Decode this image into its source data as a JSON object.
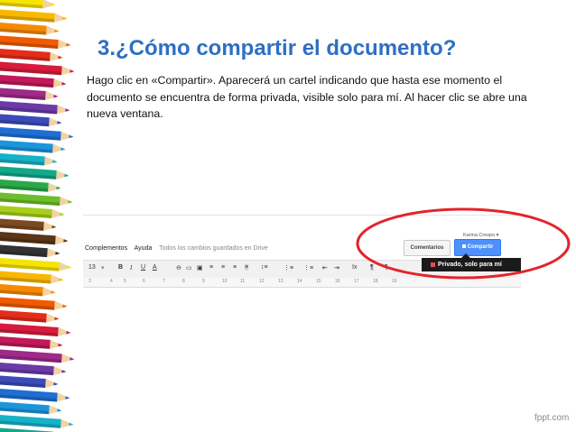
{
  "slide": {
    "title": "3.¿Cómo compartir el documento?",
    "body": "Hago clic en «Compartir». Aparecerá un cartel indicando que hasta ese momento el documento se encuentra de forma privada, visible solo para mí. Al hacer clic se abre una nueva ventana."
  },
  "screenshot": {
    "menu": [
      "Complementos",
      "Ayuda"
    ],
    "saved_status": "Todos los cambios guardados en Drive",
    "user_name": "Karina Crespo ▾",
    "comments_button": "Comentarios",
    "share_button": "Compartir",
    "share_tooltip": "Privado, solo para mí",
    "font_size": "13",
    "ruler_ticks": [
      "3",
      "4",
      "5",
      "6",
      "7",
      "8",
      "9",
      "10",
      "11",
      "12",
      "13",
      "14",
      "15",
      "16",
      "17",
      "18",
      "19"
    ]
  },
  "footer": {
    "logo": "fppt.com"
  },
  "colors": {
    "title": "#2e6fc4",
    "share_button": "#4d90fe",
    "highlight_oval": "#e3242b",
    "tooltip_bg": "#1a1a1a"
  }
}
